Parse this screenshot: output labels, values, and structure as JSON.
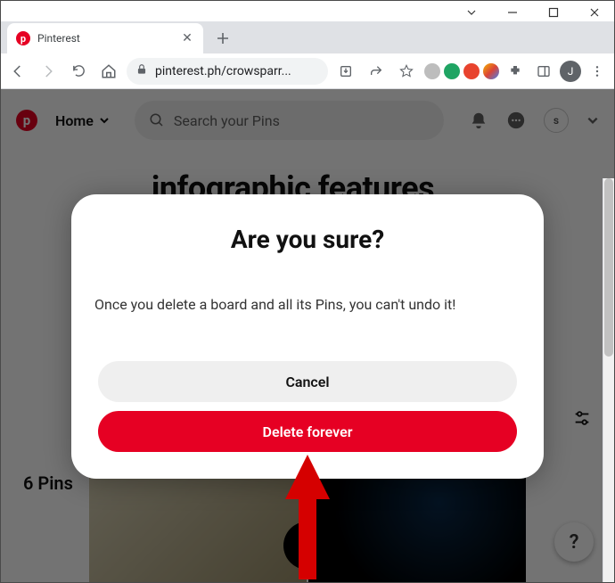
{
  "window": {
    "min": "minimize",
    "max": "maximize",
    "close": "close"
  },
  "browser": {
    "tab_title": "Pinterest",
    "newtab": "+",
    "url_display": "pinterest.ph/crowsparr...",
    "avatar_letter": "J",
    "ext_colors": [
      "#bdbdbd",
      "#1fa463",
      "#e8432e",
      "#f4b400"
    ]
  },
  "pinterest": {
    "home_label": "Home",
    "search_placeholder": "Search your Pins",
    "profile_initial": "s",
    "board_title": "infographic features",
    "pin_count_label": "6 Pins",
    "help_label": "?"
  },
  "modal": {
    "title": "Are you sure?",
    "body": "Once you delete a board and all its Pins, you can't undo it!",
    "cancel_label": "Cancel",
    "delete_label": "Delete forever"
  }
}
